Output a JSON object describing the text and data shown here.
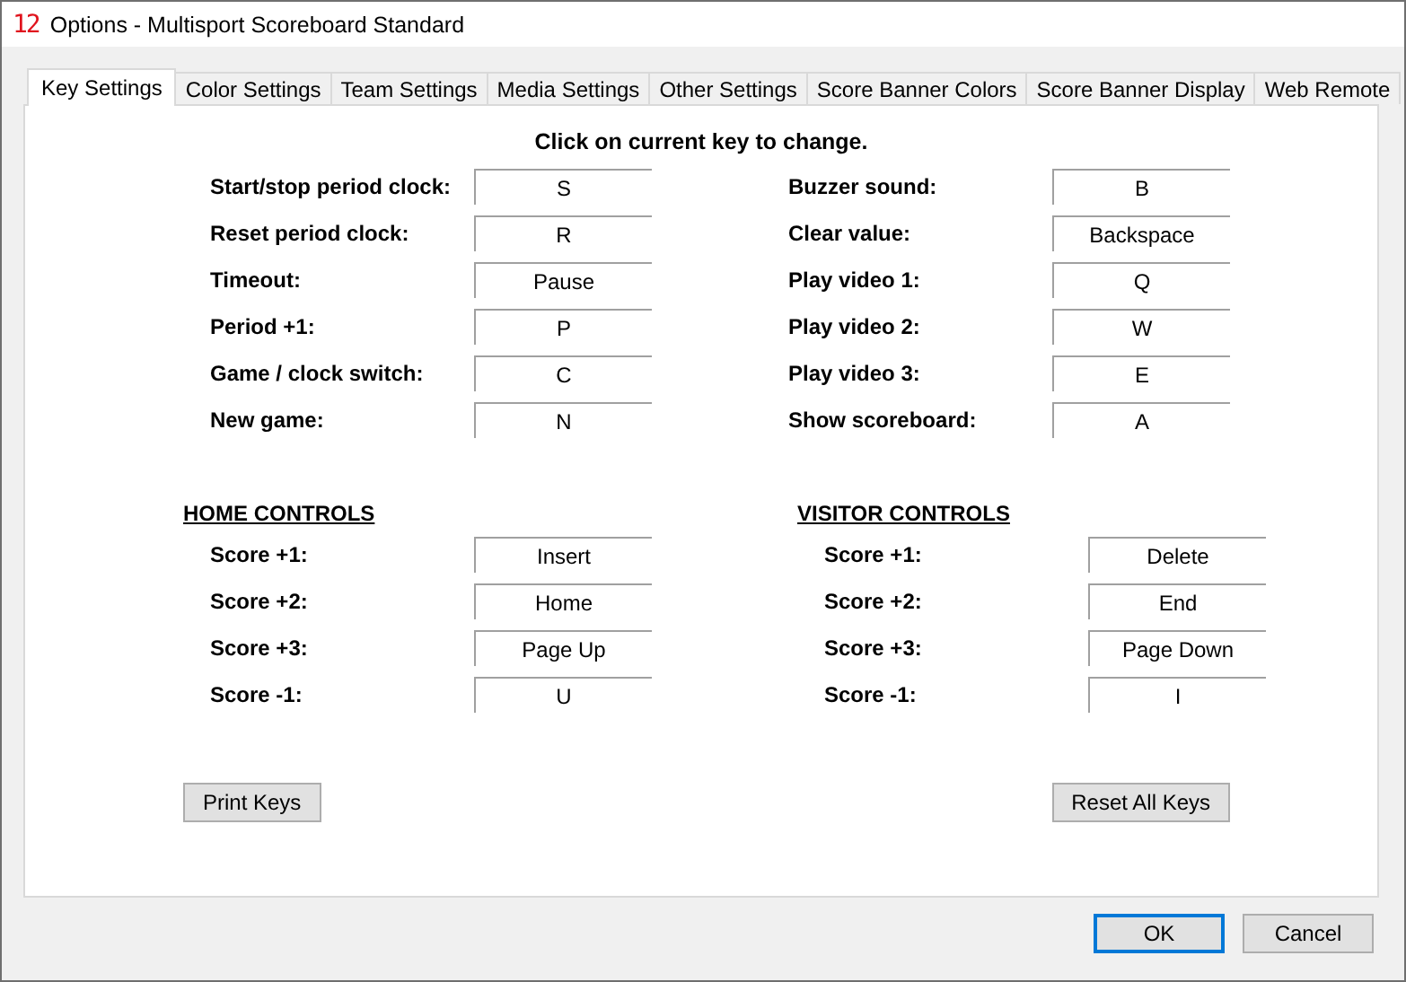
{
  "window": {
    "icon_text": "12",
    "title": "Options - Multisport Scoreboard Standard"
  },
  "tabs": [
    {
      "label": "Key Settings",
      "selected": true
    },
    {
      "label": "Color Settings",
      "selected": false
    },
    {
      "label": "Team Settings",
      "selected": false
    },
    {
      "label": "Media Settings",
      "selected": false
    },
    {
      "label": "Other Settings",
      "selected": false
    },
    {
      "label": "Score Banner Colors",
      "selected": false
    },
    {
      "label": "Score Banner Display",
      "selected": false
    },
    {
      "label": "Web Remote",
      "selected": false
    }
  ],
  "instruction": "Click on current key to change.",
  "general_keys": {
    "left": [
      {
        "label": "Start/stop period clock:",
        "key": "S"
      },
      {
        "label": "Reset period clock:",
        "key": "R"
      },
      {
        "label": "Timeout:",
        "key": "Pause"
      },
      {
        "label": "Period +1:",
        "key": "P"
      },
      {
        "label": "Game / clock switch:",
        "key": "C"
      },
      {
        "label": "New game:",
        "key": "N"
      }
    ],
    "right": [
      {
        "label": "Buzzer sound:",
        "key": "B"
      },
      {
        "label": "Clear value:",
        "key": "Backspace"
      },
      {
        "label": "Play video 1:",
        "key": "Q"
      },
      {
        "label": "Play video 2:",
        "key": "W"
      },
      {
        "label": "Play video 3:",
        "key": "E"
      },
      {
        "label": "Show scoreboard:",
        "key": "A"
      }
    ]
  },
  "team_controls": [
    {
      "title": "HOME CONTROLS",
      "keys": [
        {
          "label": "Score +1:",
          "key": "Insert"
        },
        {
          "label": "Score +2:",
          "key": "Home"
        },
        {
          "label": "Score +3:",
          "key": "Page Up"
        },
        {
          "label": "Score -1:",
          "key": "U"
        }
      ]
    },
    {
      "title": "VISITOR CONTROLS",
      "keys": [
        {
          "label": "Score +1:",
          "key": "Delete"
        },
        {
          "label": "Score +2:",
          "key": "End"
        },
        {
          "label": "Score +3:",
          "key": "Page Down"
        },
        {
          "label": "Score -1:",
          "key": "I"
        }
      ]
    }
  ],
  "panel_buttons": [
    "Print Keys",
    "Reset All Keys"
  ],
  "dialog_buttons": [
    {
      "label": "OK",
      "default": true
    },
    {
      "label": "Cancel",
      "default": false
    }
  ]
}
